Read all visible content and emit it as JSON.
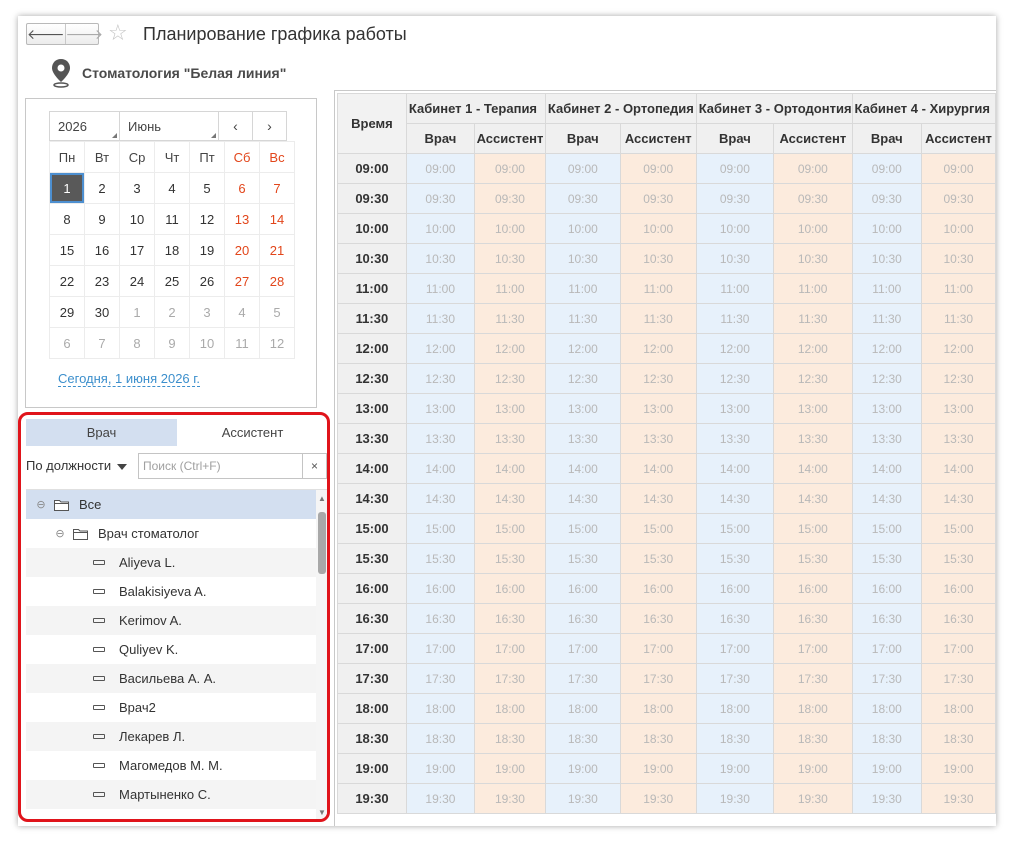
{
  "header": {
    "back_label": "🡐",
    "forward_label": "🡒",
    "title": "Планирование графика работы",
    "org_name": "Стоматология \"Белая линия\""
  },
  "calendar": {
    "year": "2026",
    "month": "Июнь",
    "prev_label": "‹",
    "next_label": "›",
    "weekdays": [
      "Пн",
      "Вт",
      "Ср",
      "Чт",
      "Пт",
      "Сб",
      "Вс"
    ],
    "weeks": [
      [
        "1",
        "2",
        "3",
        "4",
        "5",
        "6",
        "7"
      ],
      [
        "8",
        "9",
        "10",
        "11",
        "12",
        "13",
        "14"
      ],
      [
        "15",
        "16",
        "17",
        "18",
        "19",
        "20",
        "21"
      ],
      [
        "22",
        "23",
        "24",
        "25",
        "26",
        "27",
        "28"
      ],
      [
        "29",
        "30",
        "1",
        "2",
        "3",
        "4",
        "5"
      ],
      [
        "6",
        "7",
        "8",
        "9",
        "10",
        "11",
        "12"
      ]
    ],
    "today_link": "Сегодня, 1 июня 2026 г.",
    "weekend_color": "#e2461b",
    "selected_color": "#595959"
  },
  "staff_panel": {
    "tabs": [
      "Врач",
      "Ассистент"
    ],
    "active_tab": 0,
    "filter_label": "По должности",
    "search_placeholder": "Поиск (Ctrl+F)",
    "clear_label": "×",
    "tree": {
      "root_label": "Все",
      "group_label": "Врач стоматолог",
      "items": [
        "Aliyeva L.",
        "Balakisiyeva A.",
        "Kerimov A.",
        "Quliyev K.",
        "Васильева А. А.",
        "Врач2",
        "Лекарев Л.",
        "Магомедов М. М.",
        "Мартыненко С."
      ]
    },
    "highlight_color": "#e0141b"
  },
  "schedule": {
    "time_header": "Время",
    "cabinets": [
      "Кабинет 1 - Терапия",
      "Кабинет 2 - Ортопедия",
      "Кабинет 3 - Ортодонтия",
      "Кабинет 4 - Хирургия"
    ],
    "sub_headers": [
      "Врач",
      "Ассистент"
    ],
    "times": [
      "09:00",
      "09:30",
      "10:00",
      "10:30",
      "11:00",
      "11:30",
      "12:00",
      "12:30",
      "13:00",
      "13:30",
      "14:00",
      "14:30",
      "15:00",
      "15:30",
      "16:00",
      "16:30",
      "17:00",
      "17:30",
      "18:00",
      "18:30",
      "19:00",
      "19:30"
    ],
    "doctor_color": "#e7f1fb",
    "assistant_color": "#fcebdd"
  }
}
